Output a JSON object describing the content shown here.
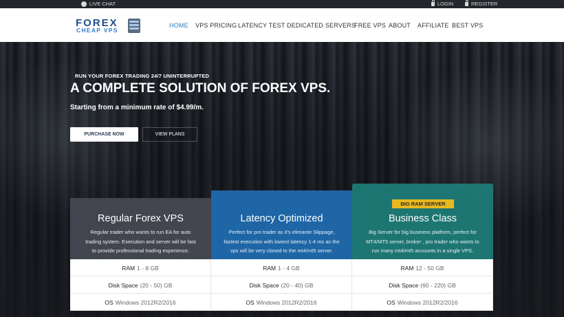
{
  "topbar": {
    "live_chat": "LIVE CHAT",
    "login": "LOGIN",
    "register": "REGISTER"
  },
  "logo": {
    "line1": "FOREX",
    "line2": "CHEAP VPS"
  },
  "nav": [
    {
      "label": "HOME",
      "active": true
    },
    {
      "label": "VPS PRICING"
    },
    {
      "label": "LATENCY TEST"
    },
    {
      "label": "DEDICATED SERVERS"
    },
    {
      "label": "FREE VPS"
    },
    {
      "label": "ABOUT"
    },
    {
      "label": "AFFILIATE"
    },
    {
      "label": "BEST VPS"
    }
  ],
  "hero": {
    "eyebrow": "RUN YOUR FOREX TRADING 24/7 UNINTERRUPTED",
    "headline": "A COMPLETE SOLUTION OF FOREX VPS.",
    "subline": "Starting from a minimum rate of $4.99/m.",
    "purchase_button": "PURCHASE NOW",
    "plans_button": "VIEW PLANS"
  },
  "plans": [
    {
      "title": "Regular Forex VPS",
      "desc": [
        "Regular trader who wants to run EA for auto",
        "trading system. Execution and server will be fast",
        "to provide professional trading experience."
      ],
      "color": "#464a54",
      "specs": [
        {
          "label": "RAM",
          "value": "1 - 8 GB"
        },
        {
          "label": "Disk Space",
          "value": "(20 - 50) GB"
        },
        {
          "label": "OS",
          "value": "Windows 2012R2/2016"
        }
      ]
    },
    {
      "title": "Latency Optimized",
      "desc": [
        "Perfect for pro trader as it's elimante Slippage,",
        "fastest execution with lowest latency 1-4 ms as the",
        "vps will be very closed to the mt4/mt5 server."
      ],
      "color": "#206cb2",
      "specs": [
        {
          "label": "RAM",
          "value": "1 - 4 GB"
        },
        {
          "label": "Disk Space",
          "value": "(20 - 40) GB"
        },
        {
          "label": "OS",
          "value": "Windows 2012R2/2016"
        }
      ]
    },
    {
      "badge": "BIG RAM SERVER",
      "title": "Business Class",
      "desc": [
        "Big Server for big business platform, perfect for",
        "MT4/MT5 server, broker , pro trader who wants to",
        "run many mt4/mt5 accounts in a single VPS."
      ],
      "color": "#1e7e7a",
      "specs": [
        {
          "label": "RAM",
          "value": "12 - 50 GB"
        },
        {
          "label": "Disk Space",
          "value": "(60 - 220) GB"
        },
        {
          "label": "OS",
          "value": "Windows 2012R2/2016"
        }
      ]
    }
  ],
  "colors": {
    "accent": "#2a7ec3",
    "badge": "#e8b81f"
  }
}
